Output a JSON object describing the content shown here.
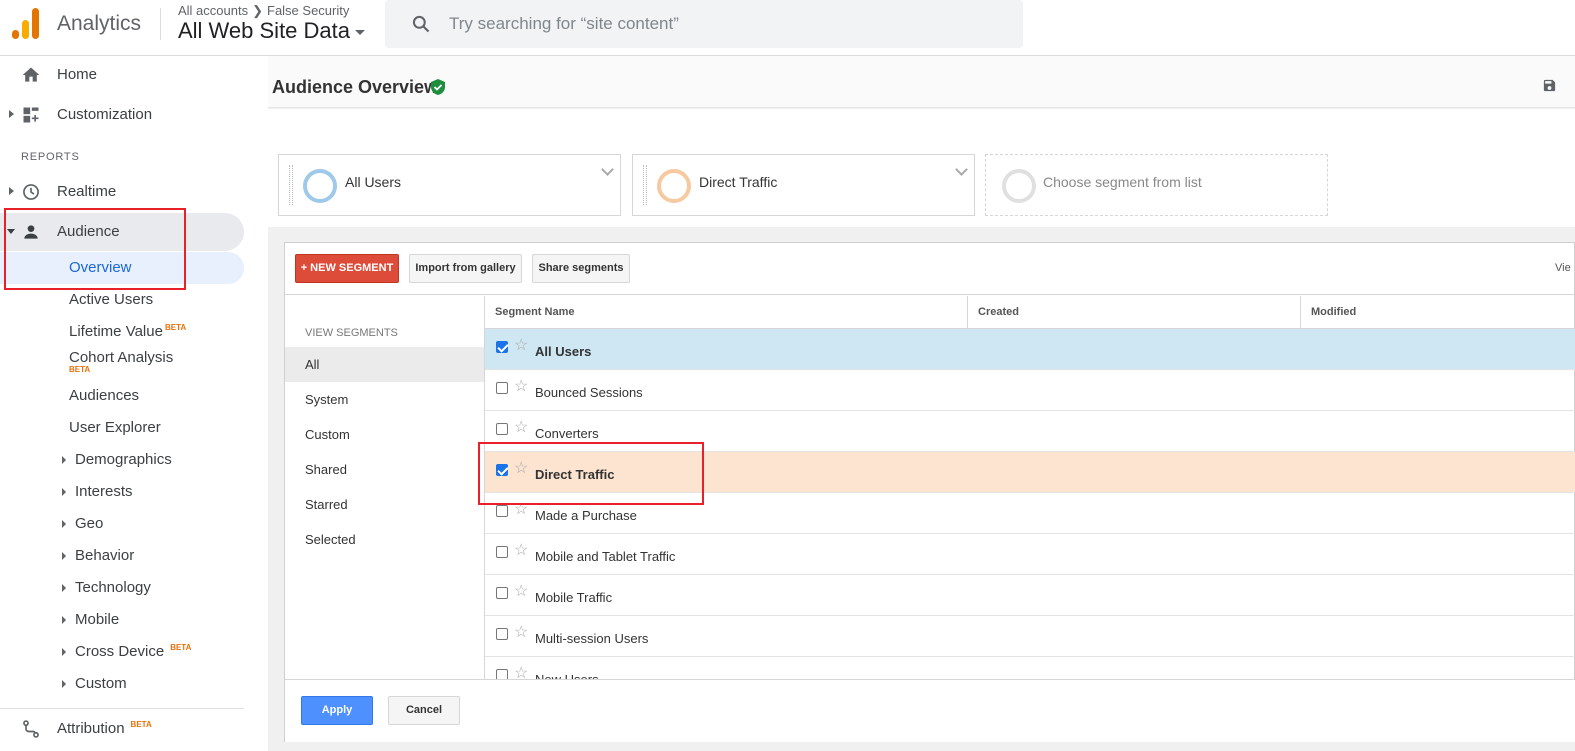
{
  "header": {
    "app_name": "Analytics",
    "breadcrumb_account": "All accounts",
    "breadcrumb_property": "False Security",
    "view_name": "All Web Site Data",
    "search_placeholder": "Try searching for “site content”"
  },
  "sidebar": {
    "home": "Home",
    "customization": "Customization",
    "reports_header": "REPORTS",
    "realtime": "Realtime",
    "audience": "Audience",
    "beta": "BETA",
    "audience_items": [
      {
        "label": "Overview"
      },
      {
        "label": "Active Users"
      },
      {
        "label": "Lifetime Value"
      },
      {
        "label": "Cohort Analysis"
      },
      {
        "label": "Audiences"
      },
      {
        "label": "User Explorer"
      },
      {
        "label": "Demographics"
      },
      {
        "label": "Interests"
      },
      {
        "label": "Geo"
      },
      {
        "label": "Behavior"
      },
      {
        "label": "Technology"
      },
      {
        "label": "Mobile"
      },
      {
        "label": "Cross Device"
      },
      {
        "label": "Custom"
      }
    ],
    "attribution": "Attribution"
  },
  "main": {
    "page_title": "Audience Overview",
    "segments": [
      {
        "name": "All Users",
        "color": "#9fc9e8"
      },
      {
        "name": "Direct Traffic",
        "color": "#f7c9a0"
      },
      {
        "name": "Choose segment from list",
        "color": "#e0e0e0"
      }
    ],
    "toolbar": {
      "new_segment": "+ NEW SEGMENT",
      "import": "Import from gallery",
      "share": "Share segments",
      "view_cut": "Vie"
    },
    "view_segments": {
      "header": "VIEW SEGMENTS",
      "items": [
        "All",
        "System",
        "Custom",
        "Shared",
        "Starred",
        "Selected"
      ],
      "active": "All"
    },
    "table": {
      "columns": [
        "Segment Name",
        "Created",
        "Modified"
      ],
      "rows": [
        {
          "name": "All Users",
          "checked": true
        },
        {
          "name": "Bounced Sessions",
          "checked": false
        },
        {
          "name": "Converters",
          "checked": false
        },
        {
          "name": "Direct Traffic",
          "checked": true
        },
        {
          "name": "Made a Purchase",
          "checked": false
        },
        {
          "name": "Mobile and Tablet Traffic",
          "checked": false
        },
        {
          "name": "Mobile Traffic",
          "checked": false
        },
        {
          "name": "Multi-session Users",
          "checked": false
        },
        {
          "name": "New Users",
          "checked": false
        }
      ]
    },
    "footer": {
      "apply": "Apply",
      "cancel": "Cancel"
    }
  },
  "colors": {
    "highlight_box": "#e8202a",
    "row_selected_blue": "#cfe7f3",
    "row_selected_orange": "#fce4d0",
    "new_segment_btn": "#dd4b39",
    "apply_btn": "#4d90fe"
  }
}
